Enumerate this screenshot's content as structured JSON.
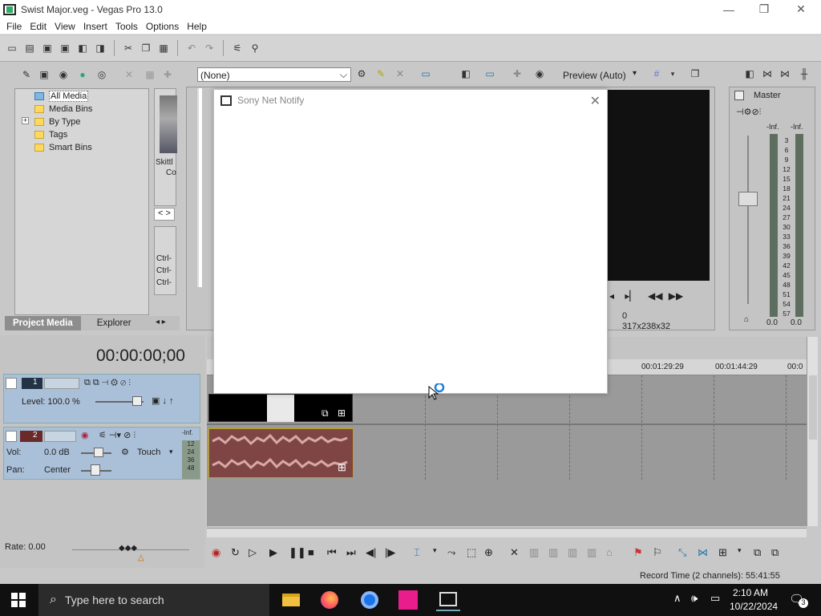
{
  "window": {
    "title": "Swist Major.veg - Vegas Pro 13.0",
    "min_symbol": "—",
    "max_symbol": "❐",
    "close_symbol": "✕"
  },
  "menu": [
    "File",
    "Edit",
    "View",
    "Insert",
    "Tools",
    "Options",
    "Help"
  ],
  "preview": {
    "fx_dropdown": "(None)",
    "mode_dropdown": "Preview (Auto)",
    "frame_label": "0",
    "display_label": "317x238x32"
  },
  "explorer": {
    "items": [
      "All Media",
      "Media Bins",
      "By Type",
      "Tags",
      "Smart Bins"
    ],
    "expand_symbol": "+",
    "tabs": [
      "Project Media",
      "Explorer"
    ],
    "thumb_label_1": "Skittl",
    "thumb_label_2": "Co",
    "thumb_nav": "< >",
    "ctrl_items": [
      "Ctrl-",
      "Ctrl-",
      "Ctrl-"
    ]
  },
  "dialog": {
    "title": "Sony Net Notify",
    "close_symbol": "✕"
  },
  "master": {
    "label": "Master",
    "db_left": "-Inf.",
    "db_right": "-Inf.",
    "scale": [
      "3",
      "6",
      "9",
      "12",
      "15",
      "18",
      "21",
      "24",
      "27",
      "30",
      "33",
      "36",
      "39",
      "42",
      "45",
      "48",
      "51",
      "54",
      "57"
    ],
    "bottom_left": "0.0",
    "bottom_right": "0.0"
  },
  "timeline": {
    "timecode": "00:00:00;00",
    "ruler_marks": [
      "00:01:29:29",
      "00:01:44:29",
      "00:0"
    ],
    "video_track": {
      "number": "1",
      "level_label": "Level: 100.0 %"
    },
    "audio_track": {
      "number": "2",
      "vol_label": "Vol:",
      "vol_value": "0.0 dB",
      "pan_label": "Pan:",
      "pan_value": "Center",
      "mode": "Touch",
      "meter_top": "-Inf.",
      "meter_vals": [
        "12",
        "24",
        "36",
        "48"
      ]
    },
    "rate": "Rate: 0.00"
  },
  "statusbar": {
    "record_time": "Record Time (2 channels): 55:41:55"
  },
  "taskbar": {
    "search_placeholder": "Type here to search",
    "time": "2:10 AM",
    "date": "10/22/2024",
    "notification_count": "3"
  },
  "colors": {
    "audio_event": "#8a4a4a",
    "track_header_blue": "#aac0d8",
    "taskbar": "#101010"
  }
}
